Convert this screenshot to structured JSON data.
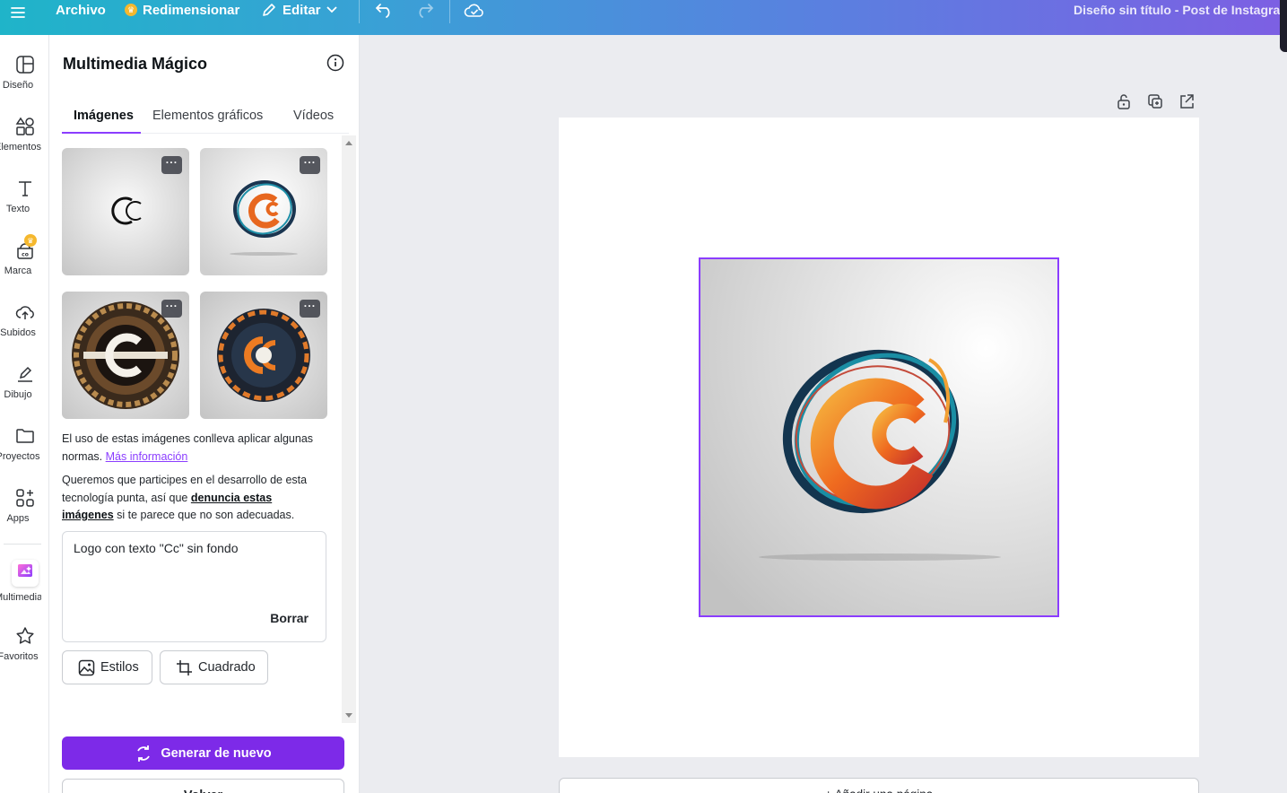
{
  "topbar": {
    "file": "Archivo",
    "resize": "Redimensionar",
    "edit": "Editar",
    "doc_title": "Diseño sin título - Post de Instagram"
  },
  "rail": {
    "items": [
      {
        "label": "Diseño",
        "icon": "layout-icon"
      },
      {
        "label": "Elementos",
        "icon": "shapes-icon"
      },
      {
        "label": "Texto",
        "icon": "text-icon"
      },
      {
        "label": "Marca",
        "icon": "brand-icon"
      },
      {
        "label": "Subidos",
        "icon": "upload-cloud-icon"
      },
      {
        "label": "Dibujo",
        "icon": "draw-icon"
      },
      {
        "label": "Proyectos",
        "icon": "folder-icon"
      },
      {
        "label": "Apps",
        "icon": "apps-icon"
      },
      {
        "label": "Multimedia ...",
        "icon": "magic-media-icon"
      },
      {
        "label": "Favoritos",
        "icon": "star-icon"
      }
    ]
  },
  "panel": {
    "title": "Multimedia Mágico",
    "tabs": [
      "Imágenes",
      "Elementos gráficos",
      "Vídeos"
    ],
    "thumb_menu": "···",
    "notice1_text": "El uso de estas imágenes conlleva aplicar algunas normas.",
    "notice1_link": "Más información",
    "notice2_a": "Queremos que participes en el desarrollo de esta tecnología punta, así que",
    "notice2_link": "denuncia estas imágenes",
    "notice2_b": "si te parece que no son adecuadas.",
    "prompt": "Logo con texto \"Cc\" sin fondo",
    "clear": "Borrar",
    "styles": "Estilos",
    "aspect": "Cuadrado",
    "generate": "Generar de nuevo",
    "back": "Volver"
  },
  "canvas": {
    "add_page": "+ Añadir una página"
  },
  "colors": {
    "accent": "#8b3dff",
    "generate_button": "#7d2ae8"
  }
}
